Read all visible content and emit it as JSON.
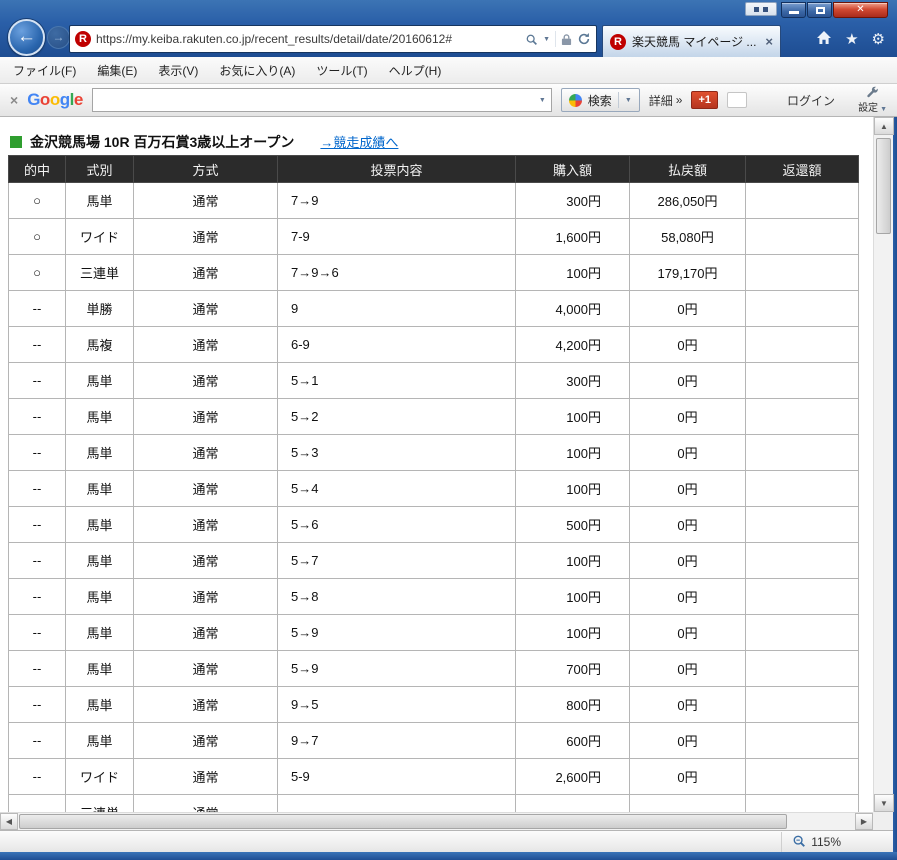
{
  "icons": {
    "favicon_letter": "R",
    "back_arrow": "←",
    "forward_arrow": "→",
    "close": "✕",
    "tab_close": "×",
    "toolbar_close": "×",
    "dropdown_caret": "▼",
    "details_chevron": "»",
    "scroll_up": "▲",
    "scroll_down": "▼",
    "scroll_left": "◀",
    "scroll_right": "▶",
    "star": "★",
    "gear": "⚙"
  },
  "browser": {
    "url": "https://my.keiba.rakuten.co.jp/recent_results/detail/date/20160612#",
    "tab_title": "楽天競馬 マイページ ...",
    "menu_items": [
      "ファイル(F)",
      "編集(E)",
      "表示(V)",
      "お気に入り(A)",
      "ツール(T)",
      "ヘルプ(H)"
    ]
  },
  "toolbar": {
    "logo_letters": [
      "G",
      "o",
      "o",
      "g",
      "l",
      "e"
    ],
    "search_value": "",
    "search_button_label": "検索",
    "details_label": "詳細",
    "plus_one_label": "+1",
    "login_label": "ログイン",
    "settings_label": "設定"
  },
  "page": {
    "race_title": "金沢競馬場 10R 百万石賞3歳以上オープン",
    "results_link": "→競走成績へ"
  },
  "table": {
    "headers": [
      "的中",
      "式別",
      "方式",
      "投票内容",
      "購入額",
      "払戻額",
      "返還額"
    ],
    "rows": [
      [
        "○",
        "馬単",
        "通常",
        "7→9",
        "300円",
        "286,050円",
        ""
      ],
      [
        "○",
        "ワイド",
        "通常",
        "7-9",
        "1,600円",
        "58,080円",
        ""
      ],
      [
        "○",
        "三連単",
        "通常",
        "7→9→6",
        "100円",
        "179,170円",
        ""
      ],
      [
        "--",
        "単勝",
        "通常",
        "9",
        "4,000円",
        "0円",
        ""
      ],
      [
        "--",
        "馬複",
        "通常",
        "6-9",
        "4,200円",
        "0円",
        ""
      ],
      [
        "--",
        "馬単",
        "通常",
        "5→1",
        "300円",
        "0円",
        ""
      ],
      [
        "--",
        "馬単",
        "通常",
        "5→2",
        "100円",
        "0円",
        ""
      ],
      [
        "--",
        "馬単",
        "通常",
        "5→3",
        "100円",
        "0円",
        ""
      ],
      [
        "--",
        "馬単",
        "通常",
        "5→4",
        "100円",
        "0円",
        ""
      ],
      [
        "--",
        "馬単",
        "通常",
        "5→6",
        "500円",
        "0円",
        ""
      ],
      [
        "--",
        "馬単",
        "通常",
        "5→7",
        "100円",
        "0円",
        ""
      ],
      [
        "--",
        "馬単",
        "通常",
        "5→8",
        "100円",
        "0円",
        ""
      ],
      [
        "--",
        "馬単",
        "通常",
        "5→9",
        "100円",
        "0円",
        ""
      ],
      [
        "--",
        "馬単",
        "通常",
        "5→9",
        "700円",
        "0円",
        ""
      ],
      [
        "--",
        "馬単",
        "通常",
        "9→5",
        "800円",
        "0円",
        ""
      ],
      [
        "--",
        "馬単",
        "通常",
        "9→7",
        "600円",
        "0円",
        ""
      ],
      [
        "--",
        "ワイド",
        "通常",
        "5-9",
        "2,600円",
        "0円",
        ""
      ],
      [
        "--",
        "三連単",
        "通常",
        "",
        "",
        "",
        ""
      ]
    ]
  },
  "statusbar": {
    "zoom_level": "115%"
  },
  "colors": {
    "frame_blue": "#2a5fa8",
    "table_header_bg": "#2b2b2b",
    "marker_green": "#2f9e2f",
    "link_blue": "#0066cc",
    "close_red": "#c23b2a",
    "plus_one_red": "#b53520",
    "rakuten_red": "#bf0000",
    "google_blue": "#4285F4",
    "google_red": "#EA4335",
    "google_yellow": "#FBBC05",
    "google_green": "#34A853"
  }
}
